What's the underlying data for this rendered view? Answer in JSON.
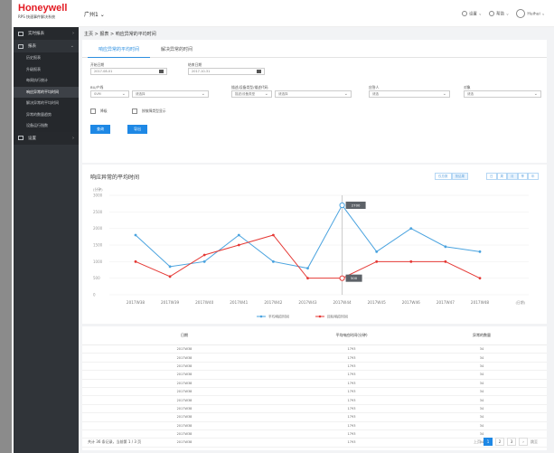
{
  "brand": {
    "name": "Honeywell",
    "subtitle": "RPS 快速事件解决系统"
  },
  "sidebar": {
    "items": [
      {
        "label": "实时报表",
        "icon": "monitor-icon"
      },
      {
        "label": "报表",
        "icon": "report-icon"
      },
      {
        "label": "设置",
        "icon": "settings-icon"
      }
    ],
    "submenu": [
      "历史报表",
      "升级报表",
      "每周执行统计",
      "响应异常的平均时间",
      "解决异常的平均时间",
      "异常的数量趋势",
      "设备运行指数"
    ]
  },
  "topbar": {
    "site": "广州1",
    "settings": "设置",
    "help": "帮助",
    "user": "Huihui"
  },
  "breadcrumb": "主页 > 报表 > 响应异常的平均时间",
  "tabs": [
    "响应异常的平均时间",
    "解决异常的时间"
  ],
  "filters": {
    "start_label": "开始日期",
    "start_value": "2017-08-01",
    "end_label": "结束日期",
    "end_value": "2017-10-31",
    "bu_label": "BU/产线",
    "bu_value1": "SVM",
    "bu_value2": "请选择",
    "station_label": "描述/设备类型/描述代码",
    "station_value1": "描述/设备类型",
    "station_value2": "请选择",
    "responder_label": "应答人",
    "responder_value": "请选",
    "object_label": "对象",
    "object_value": "请选",
    "check1": "降级",
    "check2": "按故障类型显示",
    "query_btn": "查询",
    "export_btn": "导出"
  },
  "chart": {
    "title": "响应异常的平均时间",
    "chart_toggle": [
      "仅总数",
      "按结果"
    ],
    "period_toggle": [
      "日",
      "周",
      "月",
      "季",
      "年"
    ],
    "tooltip_blue": "2700",
    "tooltip_red": "500"
  },
  "chart_data": {
    "type": "line",
    "ylabel": "(分钟)",
    "xlabel": "(日期)",
    "ylim": [
      0,
      3000
    ],
    "yticks": [
      "0",
      "500",
      "1000",
      "1500",
      "2000",
      "2500",
      "3000"
    ],
    "categories": [
      "2017W38",
      "2017W39",
      "2017W40",
      "2017W41",
      "2017W42",
      "2017W43",
      "2017W44",
      "2017W45",
      "2017W46",
      "2017W47",
      "2017W48"
    ],
    "series": [
      {
        "name": "平均响应时间",
        "color": "#4aa3df",
        "values": [
          1800,
          850,
          1000,
          1800,
          1000,
          800,
          2700,
          1300,
          2000,
          1450,
          1300
        ]
      },
      {
        "name": "目标响应时间",
        "color": "#e53935",
        "values": [
          1000,
          550,
          1200,
          1500,
          1800,
          500,
          500,
          1000,
          1000,
          1000,
          500
        ]
      }
    ]
  },
  "table": {
    "headers": [
      "日期",
      "平均响应时间(分钟)",
      "异常的数量"
    ],
    "rows": [
      [
        "2017W38",
        "1793",
        "34"
      ],
      [
        "2017W38",
        "1793",
        "34"
      ],
      [
        "2017W38",
        "1793",
        "34"
      ],
      [
        "2017W38",
        "1793",
        "34"
      ],
      [
        "2017W38",
        "1793",
        "34"
      ],
      [
        "2017W38",
        "1793",
        "34"
      ],
      [
        "2017W38",
        "1793",
        "34"
      ],
      [
        "2017W38",
        "1793",
        "34"
      ],
      [
        "2017W38",
        "1793",
        "34"
      ],
      [
        "2017W38",
        "1793",
        "34"
      ],
      [
        "2017W38",
        "1793",
        "34"
      ],
      [
        "2017W38",
        "1793",
        "34"
      ]
    ],
    "footer": "共计 36 条记录，当前第 1 / 3 页",
    "pager": {
      "prev": "上页",
      "pages": [
        "1",
        "2",
        "3"
      ],
      "next": "下页",
      "jump": "跳至"
    }
  }
}
